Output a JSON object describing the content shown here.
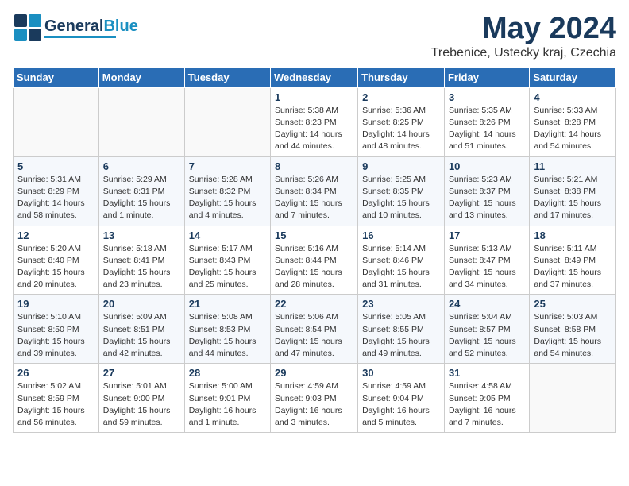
{
  "header": {
    "logo_general": "General",
    "logo_blue": "Blue",
    "month_year": "May 2024",
    "location": "Trebenice, Ustecky kraj, Czechia"
  },
  "weekdays": [
    "Sunday",
    "Monday",
    "Tuesday",
    "Wednesday",
    "Thursday",
    "Friday",
    "Saturday"
  ],
  "weeks": [
    [
      {
        "day": "",
        "info": ""
      },
      {
        "day": "",
        "info": ""
      },
      {
        "day": "",
        "info": ""
      },
      {
        "day": "1",
        "info": "Sunrise: 5:38 AM\nSunset: 8:23 PM\nDaylight: 14 hours\nand 44 minutes."
      },
      {
        "day": "2",
        "info": "Sunrise: 5:36 AM\nSunset: 8:25 PM\nDaylight: 14 hours\nand 48 minutes."
      },
      {
        "day": "3",
        "info": "Sunrise: 5:35 AM\nSunset: 8:26 PM\nDaylight: 14 hours\nand 51 minutes."
      },
      {
        "day": "4",
        "info": "Sunrise: 5:33 AM\nSunset: 8:28 PM\nDaylight: 14 hours\nand 54 minutes."
      }
    ],
    [
      {
        "day": "5",
        "info": "Sunrise: 5:31 AM\nSunset: 8:29 PM\nDaylight: 14 hours\nand 58 minutes."
      },
      {
        "day": "6",
        "info": "Sunrise: 5:29 AM\nSunset: 8:31 PM\nDaylight: 15 hours\nand 1 minute."
      },
      {
        "day": "7",
        "info": "Sunrise: 5:28 AM\nSunset: 8:32 PM\nDaylight: 15 hours\nand 4 minutes."
      },
      {
        "day": "8",
        "info": "Sunrise: 5:26 AM\nSunset: 8:34 PM\nDaylight: 15 hours\nand 7 minutes."
      },
      {
        "day": "9",
        "info": "Sunrise: 5:25 AM\nSunset: 8:35 PM\nDaylight: 15 hours\nand 10 minutes."
      },
      {
        "day": "10",
        "info": "Sunrise: 5:23 AM\nSunset: 8:37 PM\nDaylight: 15 hours\nand 13 minutes."
      },
      {
        "day": "11",
        "info": "Sunrise: 5:21 AM\nSunset: 8:38 PM\nDaylight: 15 hours\nand 17 minutes."
      }
    ],
    [
      {
        "day": "12",
        "info": "Sunrise: 5:20 AM\nSunset: 8:40 PM\nDaylight: 15 hours\nand 20 minutes."
      },
      {
        "day": "13",
        "info": "Sunrise: 5:18 AM\nSunset: 8:41 PM\nDaylight: 15 hours\nand 23 minutes."
      },
      {
        "day": "14",
        "info": "Sunrise: 5:17 AM\nSunset: 8:43 PM\nDaylight: 15 hours\nand 25 minutes."
      },
      {
        "day": "15",
        "info": "Sunrise: 5:16 AM\nSunset: 8:44 PM\nDaylight: 15 hours\nand 28 minutes."
      },
      {
        "day": "16",
        "info": "Sunrise: 5:14 AM\nSunset: 8:46 PM\nDaylight: 15 hours\nand 31 minutes."
      },
      {
        "day": "17",
        "info": "Sunrise: 5:13 AM\nSunset: 8:47 PM\nDaylight: 15 hours\nand 34 minutes."
      },
      {
        "day": "18",
        "info": "Sunrise: 5:11 AM\nSunset: 8:49 PM\nDaylight: 15 hours\nand 37 minutes."
      }
    ],
    [
      {
        "day": "19",
        "info": "Sunrise: 5:10 AM\nSunset: 8:50 PM\nDaylight: 15 hours\nand 39 minutes."
      },
      {
        "day": "20",
        "info": "Sunrise: 5:09 AM\nSunset: 8:51 PM\nDaylight: 15 hours\nand 42 minutes."
      },
      {
        "day": "21",
        "info": "Sunrise: 5:08 AM\nSunset: 8:53 PM\nDaylight: 15 hours\nand 44 minutes."
      },
      {
        "day": "22",
        "info": "Sunrise: 5:06 AM\nSunset: 8:54 PM\nDaylight: 15 hours\nand 47 minutes."
      },
      {
        "day": "23",
        "info": "Sunrise: 5:05 AM\nSunset: 8:55 PM\nDaylight: 15 hours\nand 49 minutes."
      },
      {
        "day": "24",
        "info": "Sunrise: 5:04 AM\nSunset: 8:57 PM\nDaylight: 15 hours\nand 52 minutes."
      },
      {
        "day": "25",
        "info": "Sunrise: 5:03 AM\nSunset: 8:58 PM\nDaylight: 15 hours\nand 54 minutes."
      }
    ],
    [
      {
        "day": "26",
        "info": "Sunrise: 5:02 AM\nSunset: 8:59 PM\nDaylight: 15 hours\nand 56 minutes."
      },
      {
        "day": "27",
        "info": "Sunrise: 5:01 AM\nSunset: 9:00 PM\nDaylight: 15 hours\nand 59 minutes."
      },
      {
        "day": "28",
        "info": "Sunrise: 5:00 AM\nSunset: 9:01 PM\nDaylight: 16 hours\nand 1 minute."
      },
      {
        "day": "29",
        "info": "Sunrise: 4:59 AM\nSunset: 9:03 PM\nDaylight: 16 hours\nand 3 minutes."
      },
      {
        "day": "30",
        "info": "Sunrise: 4:59 AM\nSunset: 9:04 PM\nDaylight: 16 hours\nand 5 minutes."
      },
      {
        "day": "31",
        "info": "Sunrise: 4:58 AM\nSunset: 9:05 PM\nDaylight: 16 hours\nand 7 minutes."
      },
      {
        "day": "",
        "info": ""
      }
    ]
  ]
}
